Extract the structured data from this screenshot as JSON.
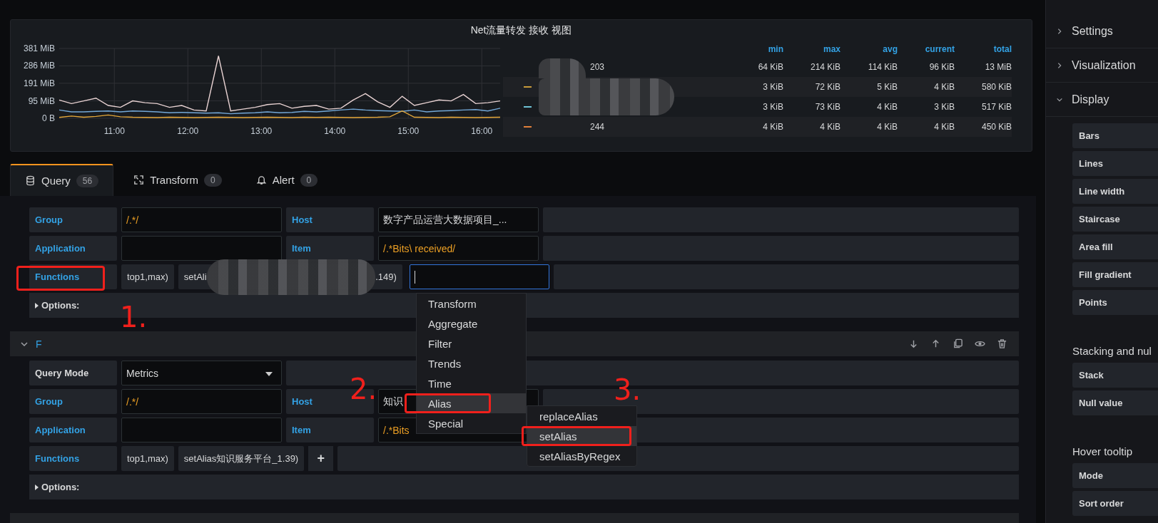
{
  "panel": {
    "title": "Net流量转发 接收 视图",
    "chart_data": {
      "type": "line",
      "grid": true,
      "xlim": [
        615,
        975
      ],
      "ylim": [
        0,
        381
      ],
      "x": [
        615,
        625,
        635,
        645,
        655,
        665,
        675,
        685,
        695,
        705,
        715,
        725,
        735,
        745,
        755,
        765,
        775,
        785,
        795,
        805,
        815,
        825,
        835,
        845,
        855,
        865,
        875,
        885,
        895,
        905,
        915,
        925,
        935,
        945,
        955,
        965,
        975
      ],
      "series": [
        {
          "color": "#e8d2d2",
          "values": [
            100,
            80,
            95,
            110,
            70,
            60,
            95,
            85,
            80,
            60,
            70,
            45,
            40,
            340,
            40,
            50,
            60,
            75,
            80,
            55,
            65,
            70,
            50,
            55,
            100,
            135,
            90,
            60,
            120,
            70,
            85,
            100,
            95,
            130,
            80,
            85,
            95
          ]
        },
        {
          "color": "#73a8d8",
          "values": [
            45,
            35,
            35,
            38,
            40,
            35,
            40,
            38,
            35,
            30,
            32,
            30,
            28,
            30,
            25,
            28,
            30,
            35,
            30,
            32,
            38,
            35,
            40,
            45,
            50,
            45,
            42,
            40,
            38,
            45,
            35,
            40,
            42,
            45,
            48,
            40,
            55
          ]
        },
        {
          "color": "#e5a83a",
          "values": [
            5,
            12,
            6,
            10,
            18,
            8,
            6,
            5,
            4,
            6,
            5,
            4,
            5,
            6,
            5,
            4,
            5,
            6,
            5,
            4,
            6,
            5,
            6,
            5,
            4,
            5,
            6,
            8,
            40,
            6,
            5,
            4,
            6,
            5,
            4,
            5,
            6
          ]
        }
      ],
      "xticks": [
        {
          "value": 660,
          "label": "11:00"
        },
        {
          "value": 720,
          "label": "12:00"
        },
        {
          "value": 780,
          "label": "13:00"
        },
        {
          "value": 840,
          "label": "14:00"
        },
        {
          "value": 900,
          "label": "15:00"
        },
        {
          "value": 960,
          "label": "16:00"
        }
      ],
      "yticks": [
        {
          "value": 0,
          "label": "0 B"
        },
        {
          "value": 95,
          "label": "95 MiB"
        },
        {
          "value": 191,
          "label": "191 MiB"
        },
        {
          "value": 286,
          "label": "286 MiB"
        },
        {
          "value": 381,
          "label": "381 MiB"
        }
      ]
    },
    "legend": {
      "columns": [
        "min",
        "max",
        "avg",
        "current",
        "total"
      ],
      "rows": [
        {
          "name": "203",
          "values": [
            "64 KiB",
            "214 KiB",
            "114 KiB",
            "96 KiB",
            "13 MiB"
          ]
        },
        {
          "color": "#c89a3a",
          "values": [
            "3 KiB",
            "72 KiB",
            "5 KiB",
            "4 KiB",
            "580 KiB"
          ]
        },
        {
          "color": "#6ec3d6",
          "values": [
            "3 KiB",
            "73 KiB",
            "4 KiB",
            "3 KiB",
            "517 KiB"
          ]
        },
        {
          "name": "244",
          "color": "#e0803a",
          "values": [
            "4 KiB",
            "4 KiB",
            "4 KiB",
            "4 KiB",
            "450 KiB"
          ]
        }
      ]
    }
  },
  "editor_tabs": [
    {
      "label": "Query",
      "count": "56",
      "selected": true
    },
    {
      "label": "Transform",
      "count": "0",
      "selected": false
    },
    {
      "label": "Alert",
      "count": "0",
      "selected": false
    }
  ],
  "queries": [
    {
      "rows": [
        {
          "kind": "pair",
          "label": "Group",
          "value": {
            "text": "/.*/",
            "kind": "regex"
          },
          "label2": "Host",
          "value2": {
            "text": "数字产品运营大数据项目_...",
            "kind": "text"
          }
        },
        {
          "kind": "pair",
          "label": "Application",
          "label2": "Item",
          "value2": {
            "text": "/.*Bits\\ received/",
            "kind": "regex"
          }
        },
        {
          "kind": "functions",
          "label": "Functions",
          "functions": [
            {
              "text": "top1,max)",
              "redacted": false
            },
            {
              "text": "setAli",
              "tail": ".149)",
              "redacted": true
            }
          ],
          "editing": true
        },
        {
          "kind": "options",
          "label": "Options:"
        }
      ]
    },
    {
      "name": "F",
      "rows": [
        {
          "kind": "select",
          "label": "Query Mode",
          "value": "Metrics"
        },
        {
          "kind": "pair",
          "label": "Group",
          "value": {
            "text": "/.*/",
            "kind": "regex"
          },
          "label2": "Host",
          "value2": {
            "text": "知识",
            "kind": "text"
          }
        },
        {
          "kind": "pair",
          "label": "Application",
          "label2": "Item",
          "value2": {
            "text": "/.*Bits",
            "kind": "regex"
          }
        },
        {
          "kind": "functions",
          "label": "Functions",
          "functions": [
            {
              "text": "top1,max)",
              "redacted": false
            },
            {
              "text": "setAlias知识服务平台_1.39)",
              "redacted": false
            }
          ],
          "editing": false,
          "add": "+"
        },
        {
          "kind": "options",
          "label": "Options:"
        }
      ]
    }
  ],
  "menu": {
    "items": [
      {
        "label": "Transform",
        "selected": false
      },
      {
        "label": "Aggregate",
        "selected": false
      },
      {
        "label": "Filter",
        "selected": false
      },
      {
        "label": "Trends",
        "selected": false
      },
      {
        "label": "Time",
        "selected": false
      },
      {
        "label": "Alias",
        "selected": true
      },
      {
        "label": "Special",
        "selected": false
      }
    ],
    "submenu": [
      {
        "label": "replaceAlias",
        "selected": false
      },
      {
        "label": "setAlias",
        "selected": true
      },
      {
        "label": "setAliasByRegex",
        "selected": false
      }
    ]
  },
  "annotations": [
    {
      "label": "1."
    },
    {
      "label": "2."
    },
    {
      "label": "3."
    }
  ],
  "sidebar": {
    "sections": [
      {
        "label": "Settings",
        "expanded": false
      },
      {
        "label": "Visualization",
        "expanded": false
      },
      {
        "label": "Display",
        "expanded": true,
        "options": [
          "Bars",
          "Lines",
          "Line width",
          "Staircase",
          "Area fill",
          "Fill gradient",
          "Points"
        ],
        "groups": [
          {
            "title": "Stacking and nul",
            "options": [
              "Stack",
              "Null value"
            ]
          },
          {
            "title": "Hover tooltip",
            "options": [
              "Mode",
              "Sort order"
            ]
          }
        ]
      }
    ]
  }
}
